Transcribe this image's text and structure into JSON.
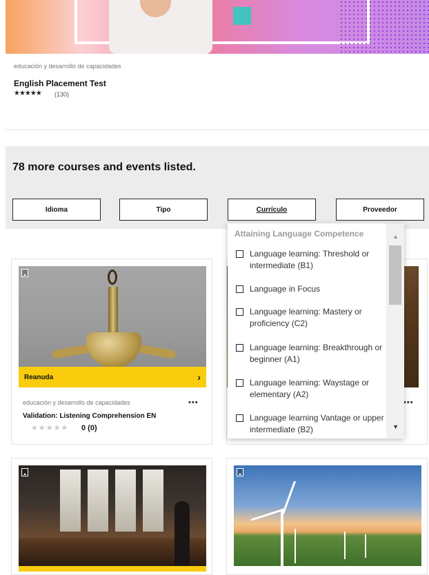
{
  "top_course": {
    "category": "educación y desarrollo de capacidades",
    "title": "English Placement Test",
    "stars": "★★★★★",
    "rating_count": "(130)"
  },
  "banner": {
    "heading": "78 more courses and events listed.",
    "filters": [
      "Idioma",
      "Tipo",
      "Currículo",
      "Proveedor"
    ]
  },
  "dropdown": {
    "heading": "Attaining Language Competence",
    "options": [
      "Language learning: Threshold or intermediate (B1)",
      "Language in Focus",
      "Language learning: Mastery or proficiency (C2)",
      "Language learning: Breakthrough or beginner (A1)",
      "Language learning: Waystage or elementary (A2)",
      "Language learning Vantage or upper intermediate (B2)"
    ],
    "scroll_up_icon": "▲",
    "scroll_down_icon": "▼"
  },
  "cards": [
    {
      "resume_label": "Reanuda",
      "resume_arrow": "›",
      "category": "educación y desarrollo de capacidades",
      "menu": "•••",
      "title": "Validation: Listening Comprehension EN",
      "stars": "★★★★★",
      "rating": "0 (0)"
    },
    {
      "menu": "•••"
    }
  ],
  "colors": {
    "accent_yellow": "#f9cc0e",
    "banner_bg": "#ececec"
  },
  "icons": [
    "bookmark-icon",
    "chevron-right-icon",
    "more-icon",
    "checkbox-icon",
    "scroll-up-icon",
    "scroll-down-icon"
  ]
}
